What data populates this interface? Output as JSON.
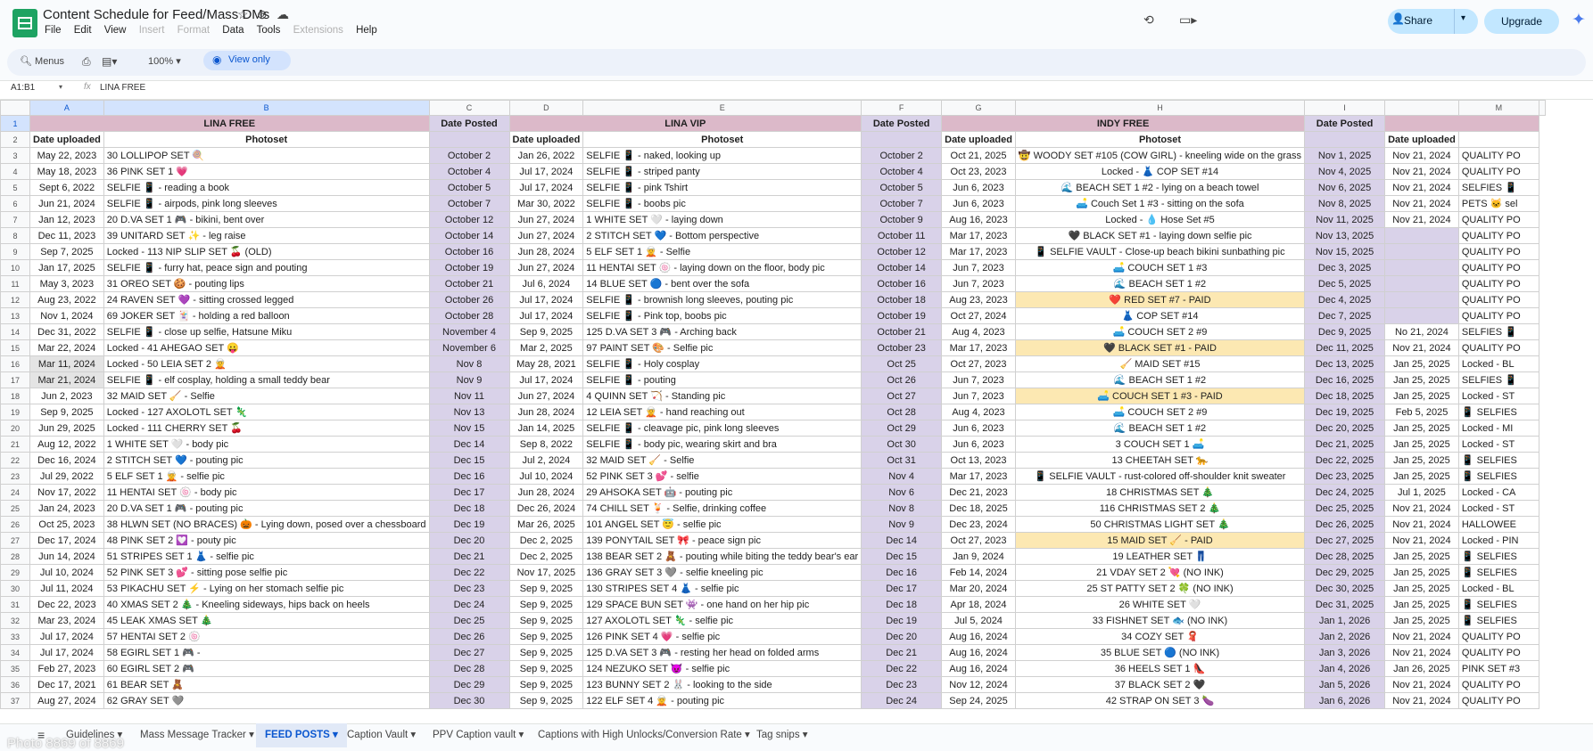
{
  "app": {
    "title": "Content Schedule for Feed/Mass DMs",
    "menus": [
      "File",
      "Edit",
      "View",
      "Insert",
      "Format",
      "Data",
      "Tools",
      "Extensions",
      "Help"
    ],
    "share_label": "Share",
    "upgrade_label": "Upgrade"
  },
  "toolbar": {
    "search_placeholder": "Menus",
    "zoom": "100%",
    "view_only": "View only"
  },
  "formula_bar": {
    "cell_ref": "A1:B1",
    "fx": "fx",
    "content": "LINA FREE"
  },
  "grid": {
    "columns": [
      "A",
      "B",
      "C",
      "D",
      "E",
      "F",
      "G",
      "H",
      "I",
      "",
      "M",
      ""
    ],
    "sections": [
      {
        "title": "LINA FREE"
      },
      {
        "title": "Date Posted"
      },
      {
        "title": "LINA VIP"
      },
      {
        "title": "Date Posted"
      },
      {
        "title": "INDY FREE"
      },
      {
        "title": "Date Posted"
      },
      {
        "title": ""
      }
    ],
    "subheaders": [
      "Date uploaded",
      "Photoset",
      "",
      "Date uploaded",
      "Photoset",
      "",
      "Date uploaded",
      "Photoset",
      "",
      "Date uploaded",
      ""
    ],
    "rows": [
      [
        "May 22, 2023",
        "30 LOLLIPOP SET 🍭",
        "October 2",
        "Jan 26, 2022",
        "SELFIE 📱 - naked, looking up",
        "October 2",
        "Oct 21, 2025",
        "🤠 WOODY SET #105 (COW GIRL) - kneeling wide on the grass",
        "Nov 1, 2025",
        "Nov 21, 2024",
        "QUALITY PO"
      ],
      [
        "May 18, 2023",
        "36 PINK SET 1 💗",
        "October 4",
        "Jul 17, 2024",
        "SELFIE 📱 - striped panty",
        "October 4",
        "Oct 23, 2023",
        "Locked - 👗 COP SET #14",
        "Nov 4, 2025",
        "Nov 21, 2024",
        "QUALITY PO"
      ],
      [
        "Sept 6, 2022",
        "SELFIE 📱 - reading a book",
        "October 5",
        "Jul 17, 2024",
        "SELFIE 📱 - pink Tshirt",
        "October 5",
        "Jun 6, 2023",
        "🌊 BEACH SET 1 #2 - lying on a beach towel",
        "Nov 6, 2025",
        "Nov 21, 2024",
        "SELFIES 📱"
      ],
      [
        "Jun 21, 2024",
        "SELFIE 📱 - airpods, pink long sleeves",
        "October 7",
        "Mar 30, 2022",
        "SELFIE 📱 - boobs pic",
        "October 7",
        "Jun 6, 2023",
        "🛋️ Couch Set 1 #3 - sitting on the sofa",
        "Nov 8, 2025",
        "Nov 21, 2024",
        "PETS 🐱 sel"
      ],
      [
        "Jan 12, 2023",
        "20 D.VA SET 1 🎮 - bikini, bent over",
        "October 12",
        "Jun 27, 2024",
        "1 WHITE SET 🤍 - laying down",
        "October 9",
        "Aug 16, 2023",
        "Locked - 💧 Hose Set #5",
        "Nov 11, 2025",
        "Nov 21, 2024",
        "QUALITY PO"
      ],
      [
        "Dec 11, 2023",
        "39 UNITARD SET ✨ - leg raise",
        "October 14",
        "Jun 27, 2024",
        "2 STITCH SET 💙 - Bottom perspective",
        "October 11",
        "Mar 17, 2023",
        "🖤 BLACK SET #1 - laying down selfie pic",
        "Nov 13, 2025",
        "",
        "QUALITY PO"
      ],
      [
        "Sep 7, 2025",
        "Locked - 113 NIP SLIP SET 🍒 (OLD)",
        "October 16",
        "Jun 28, 2024",
        "5 ELF SET 1 🧝 - Selfie",
        "October 12",
        "Mar 17, 2023",
        "📱 SELFIE VAULT - Close-up beach bikini sunbathing pic",
        "Nov 15, 2025",
        "",
        "QUALITY PO"
      ],
      [
        "Jan 17, 2025",
        "SELFIE 📱 - furry hat, peace sign and pouting",
        "October 19",
        "Jun 27, 2024",
        "11 HENTAI SET 🍥 - laying down on the floor, body pic",
        "October 14",
        "Jun 7, 2023",
        "🛋️ COUCH SET 1 #3",
        "Dec 3, 2025",
        "",
        "QUALITY PO"
      ],
      [
        "May 3, 2023",
        "31 OREO SET 🍪 - pouting lips",
        "October 21",
        "Jul 6, 2024",
        "14 BLUE SET 🔵 - bent over the sofa",
        "October 16",
        "Jun 7, 2023",
        "🌊 BEACH SET 1 #2",
        "Dec 5, 2025",
        "",
        "QUALITY PO"
      ],
      [
        "Aug 23, 2022",
        "24 RAVEN SET 💜 - sitting crossed legged",
        "October 26",
        "Jul 17, 2024",
        "SELFIE 📱 - brownish long sleeves, pouting pic",
        "October 18",
        "Aug 23, 2023",
        "❤️ RED SET #7 - PAID",
        "Dec 4, 2025",
        "",
        "QUALITY PO"
      ],
      [
        "Nov 1, 2024",
        "69 JOKER SET 🃏 - holding a red balloon",
        "October 28",
        "Jul 17, 2024",
        "SELFIE 📱 - Pink top, boobs pic",
        "October 19",
        "Oct 27, 2024",
        "👗 COP SET #14",
        "Dec 7, 2025",
        "",
        "QUALITY PO"
      ],
      [
        "Dec 31, 2022",
        "SELFIE 📱 - close up selfie, Hatsune Miku",
        "November 4",
        "Sep 9, 2025",
        "125 D.VA SET 3 🎮 - Arching back",
        "October 21",
        "Aug 4, 2023",
        "🛋️ COUCH SET 2 #9",
        "Dec 9, 2025",
        "No 21, 2024",
        "SELFIES 📱"
      ],
      [
        "Mar 22, 2024",
        "Locked - 41 AHEGAO SET 😛",
        "November 6",
        "Mar 2, 2025",
        "97 PAINT SET 🎨 - Selfie pic",
        "October 23",
        "Mar 17, 2023",
        "🖤 BLACK SET #1 - PAID",
        "Dec 11, 2025",
        "Nov 21, 2024",
        "QUALITY PO"
      ],
      [
        "Mar 11, 2024",
        "Locked - 50 LEIA SET 2 🧝",
        "Nov 8",
        "May 28, 2021",
        "SELFIE 📱 - Holy cosplay",
        "Oct 25",
        "Oct 27, 2023",
        "🧹 MAID SET #15",
        "Dec 13, 2025",
        "Jan 25, 2025",
        "Locked - BL"
      ],
      [
        "Mar 21, 2024",
        "SELFIE 📱 - elf cosplay, holding a small teddy bear",
        "Nov 9",
        "Jul 17, 2024",
        "SELFIE 📱 - pouting",
        "Oct 26",
        "Jun 7, 2023",
        "🌊 BEACH SET 1 #2",
        "Dec 16, 2025",
        "Jan 25, 2025",
        "SELFIES 📱"
      ],
      [
        "Jun 2, 2023",
        "32 MAID SET 🧹 - Selfie",
        "Nov 11",
        "Jun 27, 2024",
        "4 QUINN SET 🏹 - Standing pic",
        "Oct 27",
        "Jun 7, 2023",
        "🛋️ COUCH SET 1 #3 - PAID",
        "Dec 18, 2025",
        "Jan 25, 2025",
        "Locked - ST"
      ],
      [
        "Sep 9, 2025",
        "Locked - 127 AXOLOTL SET 🦎",
        "Nov 13",
        "Jun 28, 2024",
        "12 LEIA SET 🧝 - hand reaching out",
        "Oct 28",
        "Aug 4, 2023",
        "🛋️ COUCH SET 2 #9",
        "Dec 19, 2025",
        "Feb 5, 2025",
        "📱 SELFIES"
      ],
      [
        "Jun 29, 2025",
        "Locked - 111 CHERRY SET 🍒",
        "Nov 15",
        "Jan 14, 2025",
        "SELFIE 📱 - cleavage pic, pink long sleeves",
        "Oct 29",
        "Jun 6, 2023",
        "🌊 BEACH SET 1 #2",
        "Dec 20, 2025",
        "Jan 25, 2025",
        "Locked - MI"
      ],
      [
        "Aug 12, 2022",
        "1 WHITE SET 🤍 - body pic",
        "Dec 14",
        "Sep 8, 2022",
        "SELFIE 📱 - body pic, wearing skirt and bra",
        "Oct 30",
        "Jun 6, 2023",
        "3 COUCH SET 1 🛋️",
        "Dec 21, 2025",
        "Jan 25, 2025",
        "Locked - ST"
      ],
      [
        "Dec 16, 2024",
        "2 STITCH SET 💙 - pouting pic",
        "Dec 15",
        "Jul 2, 2024",
        "32 MAID SET 🧹 - Selfie",
        "Oct 31",
        "Oct 13, 2023",
        "13 CHEETAH SET 🐆",
        "Dec 22, 2025",
        "Jan 25, 2025",
        "📱 SELFIES"
      ],
      [
        "Jul 29, 2022",
        "5 ELF SET 1 🧝 - selfie pic",
        "Dec 16",
        "Jul 10, 2024",
        "52 PINK SET 3 💕 - selfie",
        "Nov 4",
        "Mar 17, 2023",
        "📱 SELFIE VAULT - rust-colored off-shoulder knit sweater",
        "Dec 23, 2025",
        "Jan 25, 2025",
        "📱 SELFIES"
      ],
      [
        "Nov 17, 2022",
        "11 HENTAI SET 🍥 - body pic",
        "Dec 17",
        "Jun 28, 2024",
        "29 AHSOKA SET 🤖 - pouting pic",
        "Nov 6",
        "Dec 21, 2023",
        "18 CHRISTMAS SET 🎄",
        "Dec 24, 2025",
        "Jul 1, 2025",
        "Locked - CA"
      ],
      [
        "Jan 24, 2023",
        "20 D.VA SET 1 🎮 - pouting pic",
        "Dec 18",
        "Dec 26, 2024",
        "74 CHILL SET 🍹 - Selfie, drinking coffee",
        "Nov 8",
        "Dec 18, 2025",
        "116 CHRISTMAS SET 2 🎄",
        "Dec 25, 2025",
        "Nov 21, 2024",
        "Locked - ST"
      ],
      [
        "Oct 25, 2023",
        "38 HLWN SET (NO BRACES) 🎃 - Lying down, posed over a chessboard",
        "Dec 19",
        "Mar 26, 2025",
        "101 ANGEL SET 😇 - selfie pic",
        "Nov 9",
        "Dec 23, 2024",
        "50 CHRISTMAS LIGHT SET 🎄",
        "Dec 26, 2025",
        "Nov 21, 2024",
        "HALLOWEE"
      ],
      [
        "Dec 17, 2024",
        "48 PINK SET 2 💟 - pouty pic",
        "Dec 20",
        "Dec 2, 2025",
        "139 PONYTAIL SET 🎀 - peace sign pic",
        "Dec 14",
        "Oct 27, 2023",
        "15 MAID SET 🧹 - PAID",
        "Dec 27, 2025",
        "Nov 21, 2024",
        "Locked - PIN"
      ],
      [
        "Jun 14, 2024",
        "51 STRIPES SET 1 👗 - selfie pic",
        "Dec 21",
        "Dec 2, 2025",
        "138 BEAR SET 2 🧸 - pouting while biting the teddy bear's ear",
        "Dec 15",
        "Jan 9, 2024",
        "19 LEATHER SET 👖",
        "Dec 28, 2025",
        "Jan 25, 2025",
        "📱 SELFIES"
      ],
      [
        "Jul 10, 2024",
        "52 PINK SET 3 💕 - sitting pose selfie pic",
        "Dec 22",
        "Nov 17, 2025",
        "136 GRAY SET 3 🩶 - selfie kneeling pic",
        "Dec 16",
        "Feb 14, 2024",
        "21 VDAY SET 2 💘 (NO INK)",
        "Dec 29, 2025",
        "Jan 25, 2025",
        "📱 SELFIES"
      ],
      [
        "Jul 11, 2024",
        "53 PIKACHU SET ⚡ - Lying on her stomach selfie pic",
        "Dec 23",
        "Sep 9, 2025",
        "130 STRIPES SET 4 👗 - selfie pic",
        "Dec 17",
        "Mar 20, 2024",
        "25 ST PATTY SET 2 🍀 (NO INK)",
        "Dec 30, 2025",
        "Jan 25, 2025",
        "Locked - BL"
      ],
      [
        "Dec 22, 2023",
        "40 XMAS SET 2 🎄 - Kneeling sideways, hips back on heels",
        "Dec 24",
        "Sep 9, 2025",
        "129 SPACE BUN SET 👾 - one hand on her hip pic",
        "Dec 18",
        "Apr 18, 2024",
        "26 WHITE SET 🤍",
        "Dec 31, 2025",
        "Jan 25, 2025",
        "📱 SELFIES"
      ],
      [
        "Mar 23, 2024",
        "45 LEAK XMAS SET 🎄",
        "Dec 25",
        "Sep 9, 2025",
        "127 AXOLOTL SET 🦎 - selfie pic",
        "Dec 19",
        "Jul 5, 2024",
        "33 FISHNET SET 🐟 (NO INK)",
        "Jan 1, 2026",
        "Jan 25, 2025",
        "📱 SELFIES"
      ],
      [
        "Jul 17, 2024",
        "57 HENTAI SET 2 🍥",
        "Dec 26",
        "Sep 9, 2025",
        "126 PINK SET 4 💗 - selfie pic",
        "Dec 20",
        "Aug 16, 2024",
        "34 COZY SET 🧣",
        "Jan 2, 2026",
        "Nov 21, 2024",
        "QUALITY PO"
      ],
      [
        "Jul 17, 2024",
        "58 EGIRL SET 1 🎮 -",
        "Dec 27",
        "Sep 9, 2025",
        "125 D.VA SET 3 🎮 - resting her head on folded arms",
        "Dec 21",
        "Aug 16, 2024",
        "35 BLUE SET 🔵 (NO INK)",
        "Jan 3, 2026",
        "Nov 21, 2024",
        "QUALITY PO"
      ],
      [
        "Feb 27, 2023",
        "60 EGIRL SET 2 🎮",
        "Dec 28",
        "Sep 9, 2025",
        "124 NEZUKO SET 😈 - selfie pic",
        "Dec 22",
        "Aug 16, 2024",
        "36 HEELS SET 1 👠",
        "Jan 4, 2026",
        "Jan 26, 2025",
        "PINK SET #3"
      ],
      [
        "Dec 17, 2021",
        "61 BEAR SET 🧸",
        "Dec 29",
        "Sep 9, 2025",
        "123 BUNNY SET 2 🐰 - looking to the side",
        "Dec 23",
        "Nov 12, 2024",
        "37 BLACK SET 2 🖤",
        "Jan 5, 2026",
        "Nov 21, 2024",
        "QUALITY PO"
      ],
      [
        "Aug 27, 2024",
        "62 GRAY SET 🩶",
        "Dec 30",
        "Sep 9, 2025",
        "122 ELF SET 4 🧝 - pouting pic",
        "Dec 24",
        "Sep 24, 2025",
        "42 STRAP ON SET 3 🍆",
        "Jan 6, 2026",
        "Nov 21, 2024",
        "QUALITY PO"
      ]
    ]
  },
  "tabs": [
    "Guidelines",
    "Mass Message Tracker",
    "FEED POSTS",
    "Caption Vault",
    "PPV Caption vault",
    "Captions with High Unlocks/Conversion Rate",
    "Tag snips"
  ],
  "active_tab": "FEED POSTS",
  "overlay_text": "Photo 8869 of 8869",
  "colors": {
    "section_header": "#dcb9c9",
    "date_posted_bg": "#d9d2e9",
    "paid_bg": "#fce8b2",
    "accent": "#0b57d0",
    "share_bg": "#c2e7ff"
  }
}
